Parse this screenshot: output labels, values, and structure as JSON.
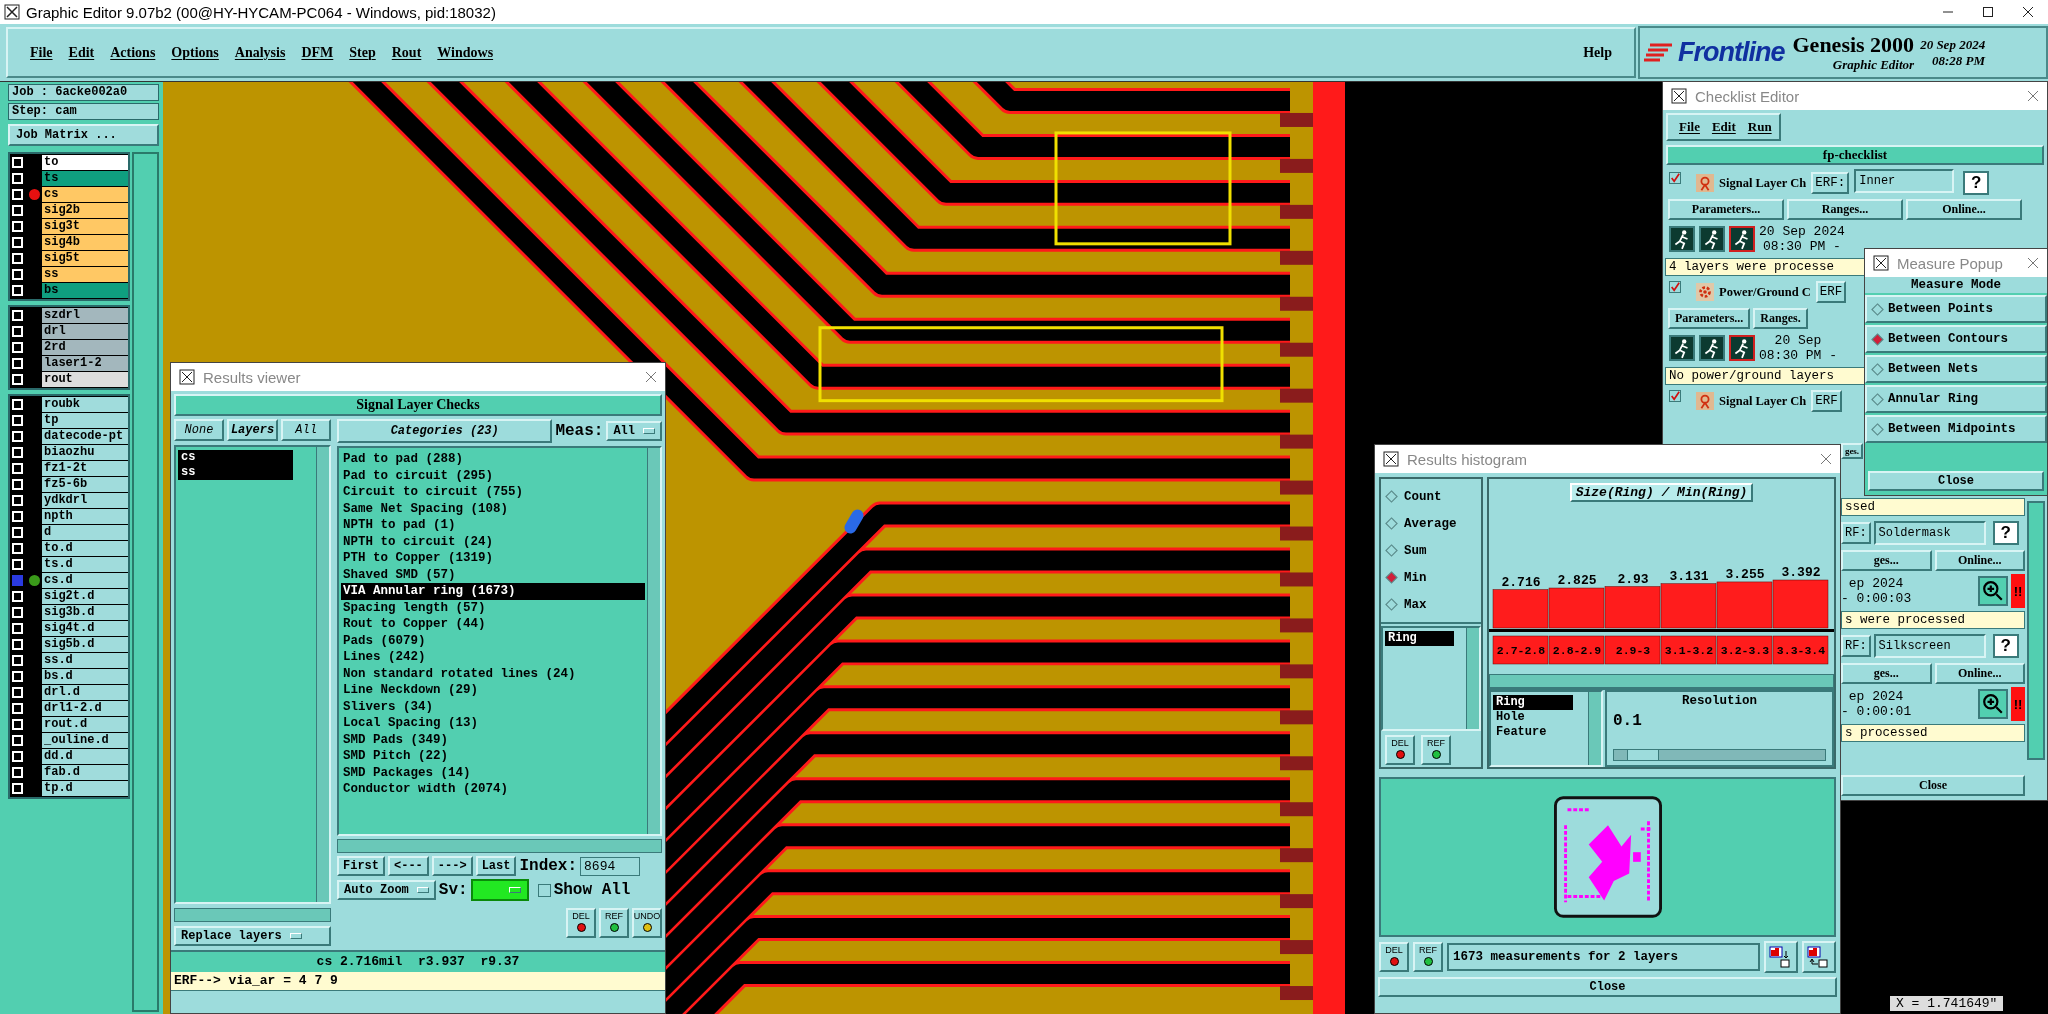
{
  "title_bar": {
    "title": "Graphic Editor 9.07b2 (00@HY-HYCAM-PC064 - Windows, pid:18032)"
  },
  "menu": [
    "File",
    "Edit",
    "Actions",
    "Options",
    "Analysis",
    "DFM",
    "Step",
    "Rout",
    "Windows"
  ],
  "help": "Help",
  "brand": {
    "logo": "Frontline",
    "product": "Genesis 2000",
    "subtitle": "Graphic Editor",
    "date": "20 Sep 2024",
    "time": "08:28 PM"
  },
  "job_panel": {
    "job": "Job : 6acke002a0",
    "step": "Step: cam",
    "matrix_button": "Job Matrix ..."
  },
  "layer_groups": [
    {
      "layers": [
        {
          "name": "to",
          "color": "#ffffff",
          "focused": false
        },
        {
          "name": "ts",
          "color": "#0f9f7f",
          "focused": false
        },
        {
          "name": "cs",
          "color": "#ffc864",
          "dot": {
            "color": "#e81010"
          },
          "focused": false
        },
        {
          "name": "sig2b",
          "color": "#ffc864",
          "focused": false
        },
        {
          "name": "sig3t",
          "color": "#ffc864",
          "focused": false
        },
        {
          "name": "sig4b",
          "color": "#ffc864",
          "focused": false
        },
        {
          "name": "sig5t",
          "color": "#ffc864",
          "focused": false
        },
        {
          "name": "ss",
          "color": "#ffc864",
          "focused": false
        },
        {
          "name": "bs",
          "color": "#0f9f7f",
          "focused": false
        }
      ]
    },
    {
      "layers": [
        {
          "name": "szdrl",
          "color": "#a3b7bd",
          "focused": false
        },
        {
          "name": "drl",
          "color": "#a3b7bd",
          "focused": false
        },
        {
          "name": "2rd",
          "color": "#a3b7bd",
          "focused": false
        },
        {
          "name": "laser1-2",
          "color": "#a3b7bd",
          "focused": false
        },
        {
          "name": "rout",
          "color": "#dddddd",
          "focused": false
        }
      ]
    },
    {
      "layers": [
        {
          "name": "roubk",
          "color": "#a0dcdc",
          "focused": false
        },
        {
          "name": "tp",
          "color": "#a0dcdc",
          "focused": false
        },
        {
          "name": "datecode-pt",
          "color": "#a0dcdc",
          "focused": false
        },
        {
          "name": "biaozhu",
          "color": "#a0dcdc",
          "focused": false
        },
        {
          "name": "fz1-2t",
          "color": "#a0dcdc",
          "focused": false
        },
        {
          "name": "fz5-6b",
          "color": "#a0dcdc",
          "focused": false
        },
        {
          "name": "ydkdrl",
          "color": "#a0dcdc",
          "focused": false
        },
        {
          "name": "npth",
          "color": "#a0dcdc",
          "focused": false
        },
        {
          "name": "d",
          "color": "#a0dcdc",
          "focused": false
        },
        {
          "name": "to.d",
          "color": "#a0dcdc",
          "focused": false
        },
        {
          "name": "ts.d",
          "color": "#a0dcdc",
          "focused": false
        },
        {
          "name": "cs.d",
          "color": "#a0dcdc",
          "dot": {
            "color": "#3a9a1a"
          },
          "focused": true
        },
        {
          "name": "sig2t.d",
          "color": "#a0dcdc",
          "focused": false
        },
        {
          "name": "sig3b.d",
          "color": "#a0dcdc",
          "focused": false
        },
        {
          "name": "sig4t.d",
          "color": "#a0dcdc",
          "focused": false
        },
        {
          "name": "sig5b.d",
          "color": "#a0dcdc",
          "focused": false
        },
        {
          "name": "ss.d",
          "color": "#a0dcdc",
          "focused": false
        },
        {
          "name": "bs.d",
          "color": "#a0dcdc",
          "focused": false
        },
        {
          "name": "drl.d",
          "color": "#a0dcdc",
          "focused": false
        },
        {
          "name": "drl1-2.d",
          "color": "#a0dcdc",
          "focused": false
        },
        {
          "name": "rout.d",
          "color": "#a0dcdc",
          "focused": false
        },
        {
          "name": "_ouline.d",
          "color": "#a0dcdc",
          "focused": false
        },
        {
          "name": "dd.d",
          "color": "#a0dcdc",
          "focused": false
        },
        {
          "name": "fab.d",
          "color": "#a0dcdc",
          "focused": false
        },
        {
          "name": "tp.d",
          "color": "#a0dcdc",
          "focused": false
        }
      ]
    }
  ],
  "results_viewer": {
    "title": "Results viewer",
    "header": "Signal Layer Checks",
    "layer_buttons": [
      "None",
      "Layers",
      "All"
    ],
    "layers": [
      {
        "name": "cs",
        "selected": true
      },
      {
        "name": "ss",
        "selected": true
      }
    ],
    "replace_button": "Replace layers",
    "categories_button": "Categories (23)",
    "meas_label": "Meas:",
    "meas_value": "All",
    "categories": [
      {
        "label": "Pad to pad (288)",
        "selected": false
      },
      {
        "label": "Pad to circuit (295)",
        "selected": false
      },
      {
        "label": "Circuit to circuit (755)",
        "selected": false
      },
      {
        "label": "Same Net Spacing (108)",
        "selected": false
      },
      {
        "label": "NPTH to pad (1)",
        "selected": false
      },
      {
        "label": "NPTH to circuit (24)",
        "selected": false
      },
      {
        "label": "PTH to Copper (1319)",
        "selected": false
      },
      {
        "label": "Shaved SMD (57)",
        "selected": false
      },
      {
        "label": "VIA Annular ring (1673)",
        "selected": true
      },
      {
        "label": "Spacing length (57)",
        "selected": false
      },
      {
        "label": "Rout to Copper (44)",
        "selected": false
      },
      {
        "label": "Pads (6079)",
        "selected": false
      },
      {
        "label": "Lines (242)",
        "selected": false
      },
      {
        "label": "Non standard rotated lines (24)",
        "selected": false
      },
      {
        "label": "Line Neckdown (29)",
        "selected": false
      },
      {
        "label": "Slivers (34)",
        "selected": false
      },
      {
        "label": "Local Spacing (13)",
        "selected": false
      },
      {
        "label": "SMD Pads (349)",
        "selected": false
      },
      {
        "label": "SMD Pitch (22)",
        "selected": false
      },
      {
        "label": "SMD Packages (14)",
        "selected": false
      },
      {
        "label": "Conductor width (2074)",
        "selected": false
      }
    ],
    "nav_buttons": [
      "First",
      "<---",
      "--->",
      "Last"
    ],
    "index_label": "Index:",
    "index_value": "8694",
    "zoom_mode": "Auto Zoom",
    "sv_label": "Sv:",
    "show_all": {
      "label": "Show All",
      "checked": false
    },
    "action_buttons": [
      "DEL",
      "REF",
      "UNDO"
    ],
    "status": "cs 2.716mil  r3.937  r9.37",
    "erf_line": "ERF--> via_ar = 4 7 9"
  },
  "checklist_editor": {
    "title": "Checklist Editor",
    "menu": [
      "File",
      "Edit",
      "Run"
    ],
    "name": "fp-checklist",
    "checks": [
      {
        "checked": true,
        "kind": "signal",
        "name": "Signal Layer Ch",
        "erf_label": "ERF:",
        "erf_value": "Inner",
        "help": "?",
        "buttons": [
          "Parameters...",
          "Ranges...",
          "Online..."
        ],
        "date": "20 Sep 2024",
        "time": "08:30 PM -",
        "status": "4 layers were processe"
      },
      {
        "checked": true,
        "kind": "power",
        "name": "Power/Ground C",
        "erf_label": "ERF",
        "buttons": [
          "Parameters...",
          "Ranges."
        ],
        "date": "20 Sep",
        "time": "08:30 PM -",
        "status": "No power/ground layers"
      },
      {
        "checked": true,
        "kind": "signal",
        "name": "Signal Layer Ch",
        "erf_label": "ERF"
      }
    ],
    "covered_rows": [
      {
        "kind": "buttons",
        "items": [
          "ges."
        ]
      },
      {
        "kind": "status",
        "text": "ssed"
      },
      {
        "kind": "erf",
        "label": "RF:",
        "value": "Soldermask",
        "help": "?"
      },
      {
        "kind": "buttons",
        "items": [
          "ges...",
          "Online..."
        ]
      },
      {
        "kind": "date",
        "date": "ep 2024",
        "time": "- 0:00:03",
        "alarm": "!!"
      },
      {
        "kind": "status",
        "text": "s were processed"
      },
      {
        "kind": "erf",
        "label": "RF:",
        "value": "Silkscreen",
        "help": "?"
      },
      {
        "kind": "buttons",
        "items": [
          "ges...",
          "Online..."
        ]
      },
      {
        "kind": "date",
        "date": "ep 2024",
        "time": "- 0:00:01",
        "alarm": "!!"
      },
      {
        "kind": "status",
        "text": "s processed"
      }
    ],
    "close": "Close"
  },
  "measure_popup": {
    "title": "Measure Popup",
    "heading": "Measure Mode",
    "modes": [
      {
        "label": "Between Points",
        "selected": false
      },
      {
        "label": "Between Contours",
        "selected": true
      },
      {
        "label": "Between Nets",
        "selected": false
      },
      {
        "label": "Annular Ring",
        "selected": false
      },
      {
        "label": "Between Midpoints",
        "selected": false
      }
    ],
    "close": "Close"
  },
  "results_histogram": {
    "title": "Results histogram",
    "modes": [
      {
        "label": "Count",
        "selected": false
      },
      {
        "label": "Average",
        "selected": false
      },
      {
        "label": "Sum",
        "selected": false
      },
      {
        "label": "Min",
        "selected": true
      },
      {
        "label": "Max",
        "selected": false
      }
    ],
    "list": [
      {
        "label": "Ring",
        "selected": true
      }
    ],
    "list_buttons": [
      "DEL",
      "REF"
    ],
    "chart_data": {
      "type": "bar",
      "title": "Size(Ring) / Min(Ring)",
      "categories": [
        "2.7-2.8",
        "2.8-2.9",
        "2.9-3",
        "3.1-3.2",
        "3.2-3.3",
        "3.3-3.4"
      ],
      "values": [
        2.716,
        2.825,
        2.93,
        3.131,
        3.255,
        3.392
      ],
      "data_labels": true
    },
    "attributes": [
      {
        "label": "Ring",
        "selected": true
      },
      {
        "label": "Hole",
        "selected": false
      },
      {
        "label": "Feature",
        "selected": false
      }
    ],
    "resolution": {
      "label": "Resolution",
      "value": "0.1",
      "level": 0.06
    },
    "footer_buttons": [
      "DEL",
      "REF"
    ],
    "summary": "1673 measurements for 2 layers",
    "close": "Close"
  },
  "coordinate_readout": "X = 1.741649\""
}
